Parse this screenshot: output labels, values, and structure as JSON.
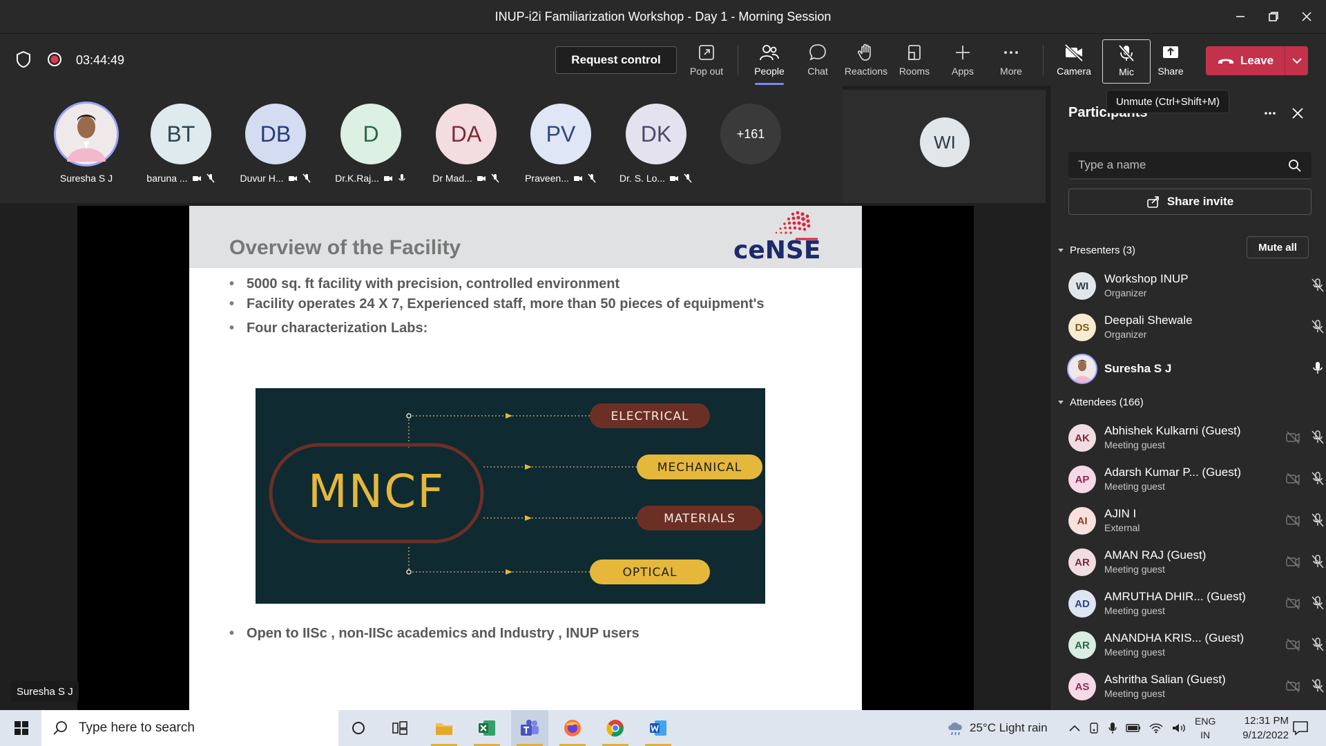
{
  "window": {
    "title": "INUP-i2i Familiarization Workshop - Day 1 - Morning Session"
  },
  "toolbar": {
    "timer": "03:44:49",
    "request_control": "Request control",
    "tools": {
      "popout": "Pop out",
      "people": "People",
      "chat": "Chat",
      "reactions": "Reactions",
      "rooms": "Rooms",
      "apps": "Apps",
      "more": "More",
      "camera": "Camera",
      "mic": "Mic",
      "share": "Share"
    },
    "leave": "Leave",
    "mic_tooltip": "Unmute (Ctrl+Shift+M)",
    "leave_color": "#c4314b",
    "accent": "#7f85f5"
  },
  "gallery": {
    "participants": [
      {
        "initials": "",
        "name": "Suresha S J",
        "bg": "#f0c6d6",
        "fg": "#333"
      },
      {
        "initials": "BT",
        "name": "baruna ...",
        "bg": "#dfeaee",
        "fg": "#2d4550"
      },
      {
        "initials": "DB",
        "name": "Duvur H...",
        "bg": "#d4dcf2",
        "fg": "#253a77"
      },
      {
        "initials": "D",
        "name": "Dr.K.Raj...",
        "bg": "#dcf0e4",
        "fg": "#2b6843"
      },
      {
        "initials": "DA",
        "name": "Dr Mad...",
        "bg": "#f4dde0",
        "fg": "#7c2a38"
      },
      {
        "initials": "PV",
        "name": "Praveen...",
        "bg": "#dfe6f6",
        "fg": "#33467d"
      },
      {
        "initials": "DK",
        "name": "Dr. S. Lo...",
        "bg": "#e5e2f0",
        "fg": "#4d476a"
      }
    ],
    "overflow": "+161",
    "stage_tile_initials": "WI"
  },
  "slide": {
    "title": "Overview of the Facility",
    "logo_text": "ceNSE",
    "bullets": [
      "5000 sq. ft facility with precision, controlled environment",
      "Facility operates 24 X 7, Experienced staff, more than 50 pieces of equipment's",
      "Four characterization Labs:",
      "Open to IISc , non-IISc academics and Industry , INUP users"
    ],
    "diagram": {
      "center": "MNCF",
      "labs": [
        "ELECTRICAL",
        "MECHANICAL",
        "MATERIALS",
        "OPTICAL"
      ],
      "colors": {
        "bg": "#0f2a30",
        "gold": "#e5b83b",
        "maroon": "#6b2f26"
      }
    },
    "presenter_tag": "Suresha S J"
  },
  "panel": {
    "title": "Participants",
    "search_placeholder": "Type a name",
    "share_invite": "Share invite",
    "presenters_header": "Presenters (3)",
    "mute_all": "Mute all",
    "presenters": [
      {
        "initials": "WI",
        "name": "Workshop INUP",
        "role": "Organizer",
        "bg": "#e1e6ea",
        "fg": "#2c3b47"
      },
      {
        "initials": "DS",
        "name": "Deepali Shewale",
        "role": "Organizer",
        "bg": "#f6ecd1",
        "fg": "#7c5b12"
      },
      {
        "initials": "",
        "name": "Suresha S J",
        "role": "",
        "bg": "#f0c6d6",
        "fg": "#333"
      }
    ],
    "attendees_header": "Attendees (166)",
    "attendees": [
      {
        "initials": "AK",
        "name": "Abhishek Kulkarni (Guest)",
        "role": "Meeting guest",
        "bg": "#f0dde2",
        "fg": "#7c2a38"
      },
      {
        "initials": "AP",
        "name": "Adarsh Kumar P...  (Guest)",
        "role": "Meeting guest",
        "bg": "#f6d9e6",
        "fg": "#8a2e58"
      },
      {
        "initials": "AI",
        "name": "AJIN I",
        "role": "External",
        "bg": "#f8e0dc",
        "fg": "#8b3b2d"
      },
      {
        "initials": "AR",
        "name": "AMAN RAJ (Guest)",
        "role": "Meeting guest",
        "bg": "#f0dde2",
        "fg": "#7c2a38"
      },
      {
        "initials": "AD",
        "name": "AMRUTHA DHIR...  (Guest)",
        "role": "Meeting guest",
        "bg": "#dde4f2",
        "fg": "#33467d"
      },
      {
        "initials": "AR",
        "name": "ANANDHA KRIS...  (Guest)",
        "role": "Meeting guest",
        "bg": "#d9ede2",
        "fg": "#2b6843"
      },
      {
        "initials": "AS",
        "name": "Ashritha Salian (Guest)",
        "role": "Meeting guest",
        "bg": "#f6d9e6",
        "fg": "#8a2e58"
      }
    ]
  },
  "taskbar": {
    "search_placeholder": "Type here to search",
    "weather": "25°C  Light rain",
    "lang_top": "ENG",
    "lang_bottom": "IN",
    "time": "12:31 PM",
    "date": "9/12/2022"
  }
}
